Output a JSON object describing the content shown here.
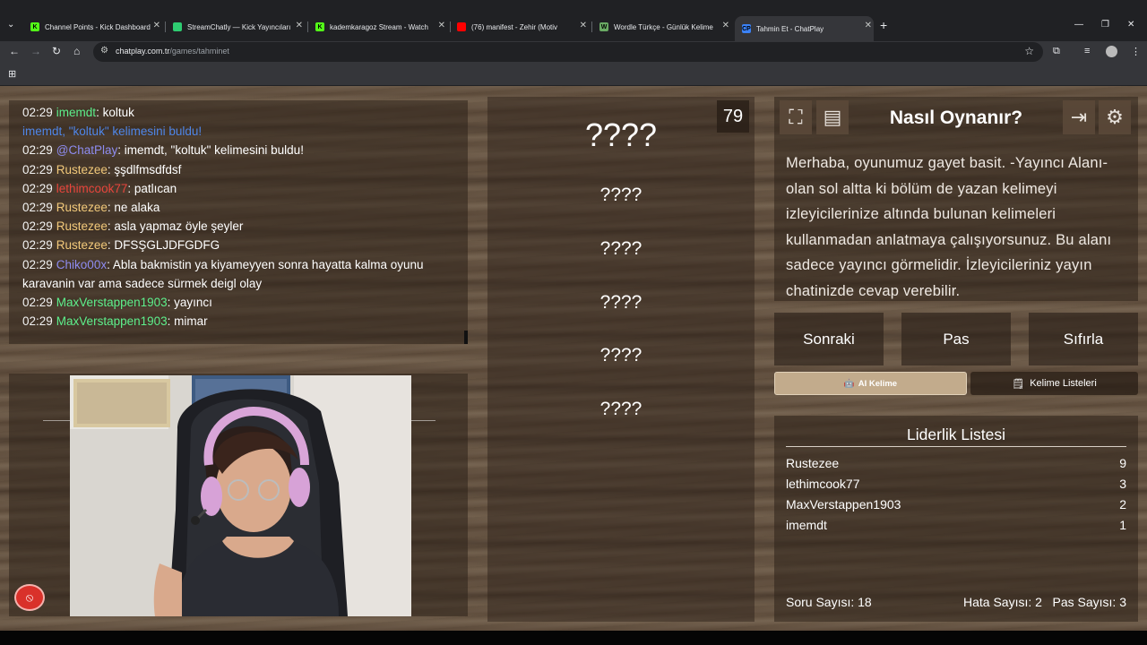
{
  "browser": {
    "tabs": [
      {
        "title": "Channel Points - Kick Dashboard",
        "fav": "K",
        "fav_color": "#53fc18"
      },
      {
        "title": "StreamChatly — Kick Yayıncıları",
        "fav": "",
        "fav_color": "#2ecc71"
      },
      {
        "title": "kademkaragoz Stream - Watch",
        "fav": "K",
        "fav_color": "#53fc18"
      },
      {
        "title": "(76) manifest - Zehir (Motiv",
        "fav": "",
        "fav_color": "#ff0000"
      },
      {
        "title": "Wordle Türkçe - Günlük Kelime",
        "fav": "W",
        "fav_color": "#6aaa64"
      },
      {
        "title": "Tahmin Et - ChatPlay",
        "fav": "CP",
        "fav_color": "#3b82f6"
      }
    ],
    "url_host": "chatplay.com.tr",
    "url_path": "/games/tahminet"
  },
  "chat": {
    "lines": [
      {
        "time": "02:29",
        "user": "imemdt",
        "user_color": "#5ef08c",
        "msg": ": koltuk"
      },
      {
        "time": "",
        "user": "",
        "user_color": "#4f86e8",
        "msg": "imemdt, \"koltuk\" kelimesini buldu!",
        "system": true
      },
      {
        "time": "02:29",
        "user": "@ChatPlay",
        "user_color": "#8e8cf0",
        "msg": ": imemdt, \"koltuk\" kelimesini buldu!"
      },
      {
        "time": "02:29",
        "user": "Rustezee",
        "user_color": "#f2c97a",
        "msg": ": şşdlfmsdfdsf"
      },
      {
        "time": "02:29",
        "user": "lethimcook77",
        "user_color": "#e8453c",
        "msg": ": patlıcan"
      },
      {
        "time": "02:29",
        "user": "Rustezee",
        "user_color": "#f2c97a",
        "msg": ": ne alaka"
      },
      {
        "time": "02:29",
        "user": "Rustezee",
        "user_color": "#f2c97a",
        "msg": ": asla yapmaz öyle şeyler"
      },
      {
        "time": "02:29",
        "user": "Rustezee",
        "user_color": "#f2c97a",
        "msg": ": DFSŞGLJDFGDFG"
      },
      {
        "time": "02:29",
        "user": "Chiko00x",
        "user_color": "#8e8cf0",
        "msg": ": Abla bakmistin ya kiyameyyen sonra hayatta kalma oyunu karavanin var ama sadece sürmek deigl olay"
      },
      {
        "time": "02:29",
        "user": "MaxVerstappen1903",
        "user_color": "#5ef08c",
        "msg": ": yayıncı"
      },
      {
        "time": "02:29",
        "user": "MaxVerstappen1903",
        "user_color": "#5ef08c",
        "msg": ": mimar"
      }
    ]
  },
  "guess": {
    "counter": "79",
    "slots": [
      "????",
      "????",
      "????",
      "????",
      "????",
      "????"
    ]
  },
  "howto": {
    "title": "Nasıl Oynanır?",
    "text": "Merhaba, oyunumuz gayet basit. -Yayıncı Alanı- olan sol altta ki bölüm de yazan kelimeyi izleyicilerinize altında bulunan kelimeleri kullanmadan anlatmaya çalışıyorsunuz. Bu alanı sadece yayıncı görmelidir. İzleyicileriniz yayın chatinizde cevap verebilir."
  },
  "buttons": {
    "next": "Sonraki",
    "pass": "Pas",
    "reset": "Sıfırla",
    "ai_word": "AI Kelime",
    "word_lists": "Kelime Listeleri"
  },
  "leaderboard": {
    "title": "Liderlik Listesi",
    "rows": [
      {
        "name": "Rustezee",
        "score": "9"
      },
      {
        "name": "lethimcook77",
        "score": "3"
      },
      {
        "name": "MaxVerstappen1903",
        "score": "2"
      },
      {
        "name": "imemdt",
        "score": "1"
      }
    ],
    "question_count": "Soru Sayısı: 18",
    "error_count": "Hata Sayısı: 2",
    "pass_count": "Pas Sayısı: 3"
  }
}
